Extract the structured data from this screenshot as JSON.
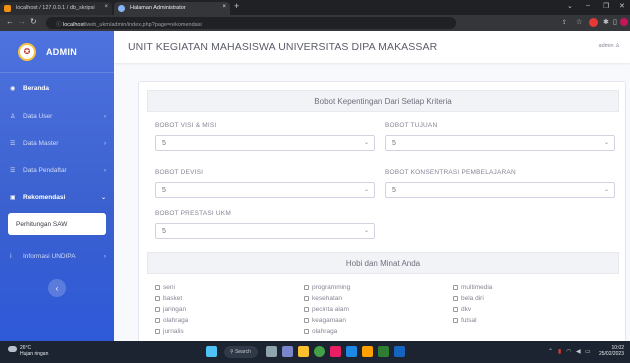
{
  "browser": {
    "tabs": [
      {
        "title": "localhost / 127.0.0.1 / db_skripsi",
        "color": "#f29111"
      },
      {
        "title": "Halaman Administrator",
        "color": "#8ab4f8"
      }
    ],
    "url_host": "localhost",
    "url_path": "/web_ukm/admin/index.php?page=rekomendasi",
    "new_tab": "+",
    "close_glyph": "×"
  },
  "sidebar": {
    "brand": "ADMIN",
    "items": [
      {
        "label": "Beranda",
        "icon": "home-icon"
      },
      {
        "label": "Data User",
        "icon": "user-icon"
      },
      {
        "label": "Data Master",
        "icon": "list-icon"
      },
      {
        "label": "Data Pendaftar",
        "icon": "list-icon"
      },
      {
        "label": "Rekomendasi",
        "icon": "book-icon"
      },
      {
        "label": "Informasi UNDIPA",
        "icon": "info-icon"
      }
    ],
    "sub_item": "Perhitungan SAW",
    "toggle_glyph": "‹"
  },
  "topbar": {
    "title": "UNIT KEGIATAN MAHASISWA UNIVERSITAS DIPA MAKASSAR",
    "user": "admin"
  },
  "form": {
    "section1": "Bobot Kepentingan Dari Setiap Kriteria",
    "fields": [
      {
        "label": "BOBOT VISI & MISI",
        "value": "5"
      },
      {
        "label": "BOBOT TUJUAN",
        "value": "5"
      },
      {
        "label": "BOBOT DEVISI",
        "value": "5"
      },
      {
        "label": "BOBOT KONSENTRASI PEMBELAJARAN",
        "value": "5"
      },
      {
        "label": "BOBOT PRESTASI UKM",
        "value": "5"
      }
    ],
    "section2": "Hobi dan Minat Anda",
    "hobbies": [
      "seni",
      "programming",
      "multimedia",
      "basket",
      "kesehatan",
      "bela diri",
      "jaringan",
      "pecinta alam",
      "dkv",
      "olahraga",
      "keagamaan",
      "futsal",
      "jurnalis",
      "olahraga"
    ]
  },
  "taskbar": {
    "temp": "26°C",
    "weather": "Hujan ringan",
    "search": "Search",
    "time": "10:02",
    "date": "25/02/2023"
  },
  "colors": {
    "sidebar": "#4e73df",
    "accent_logo_ring": "#f6c23e"
  }
}
